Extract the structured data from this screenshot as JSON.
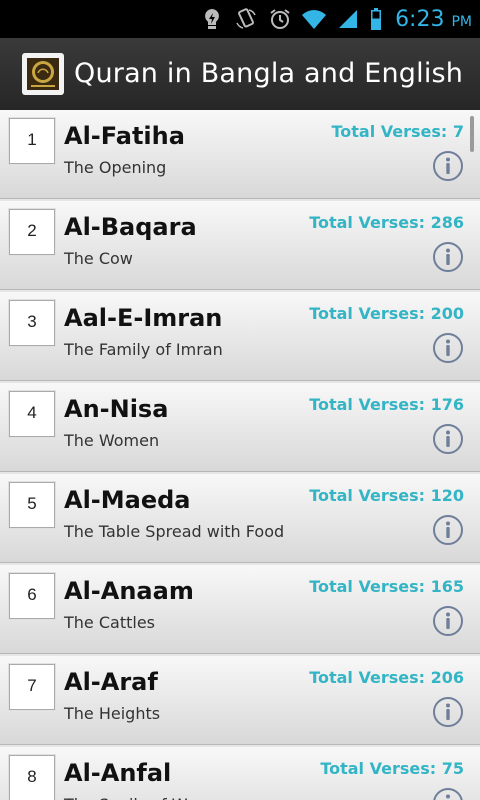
{
  "status_bar": {
    "time": "6:23",
    "ampm": "PM",
    "icons": [
      "lightbulb-icon",
      "rotation-icon",
      "alarm-icon",
      "wifi-icon",
      "signal-icon",
      "battery-icon"
    ]
  },
  "app": {
    "title": "Quran in Bangla and English",
    "logo_icon": "quran-logo"
  },
  "surahs": [
    {
      "number": "1",
      "name": "Al-Fatiha",
      "meaning": "The Opening",
      "verses": "Total Verses: 7"
    },
    {
      "number": "2",
      "name": "Al-Baqara",
      "meaning": "The Cow",
      "verses": "Total Verses: 286"
    },
    {
      "number": "3",
      "name": "Aal-E-Imran",
      "meaning": "The Family of Imran",
      "verses": "Total Verses: 200"
    },
    {
      "number": "4",
      "name": "An-Nisa",
      "meaning": "The Women",
      "verses": "Total Verses: 176"
    },
    {
      "number": "5",
      "name": "Al-Maeda",
      "meaning": "The Table Spread with Food",
      "verses": "Total Verses: 120"
    },
    {
      "number": "6",
      "name": "Al-Anaam",
      "meaning": "The Cattles",
      "verses": "Total Verses: 165"
    },
    {
      "number": "7",
      "name": "Al-Araf",
      "meaning": "The Heights",
      "verses": "Total Verses: 206"
    },
    {
      "number": "8",
      "name": "Al-Anfal",
      "meaning": "The Spoils of War",
      "verses": "Total Verses: 75"
    }
  ],
  "colors": {
    "accent": "#33b5e5",
    "verses_text": "#33b5c5",
    "info_icon": "#6f7f99"
  }
}
